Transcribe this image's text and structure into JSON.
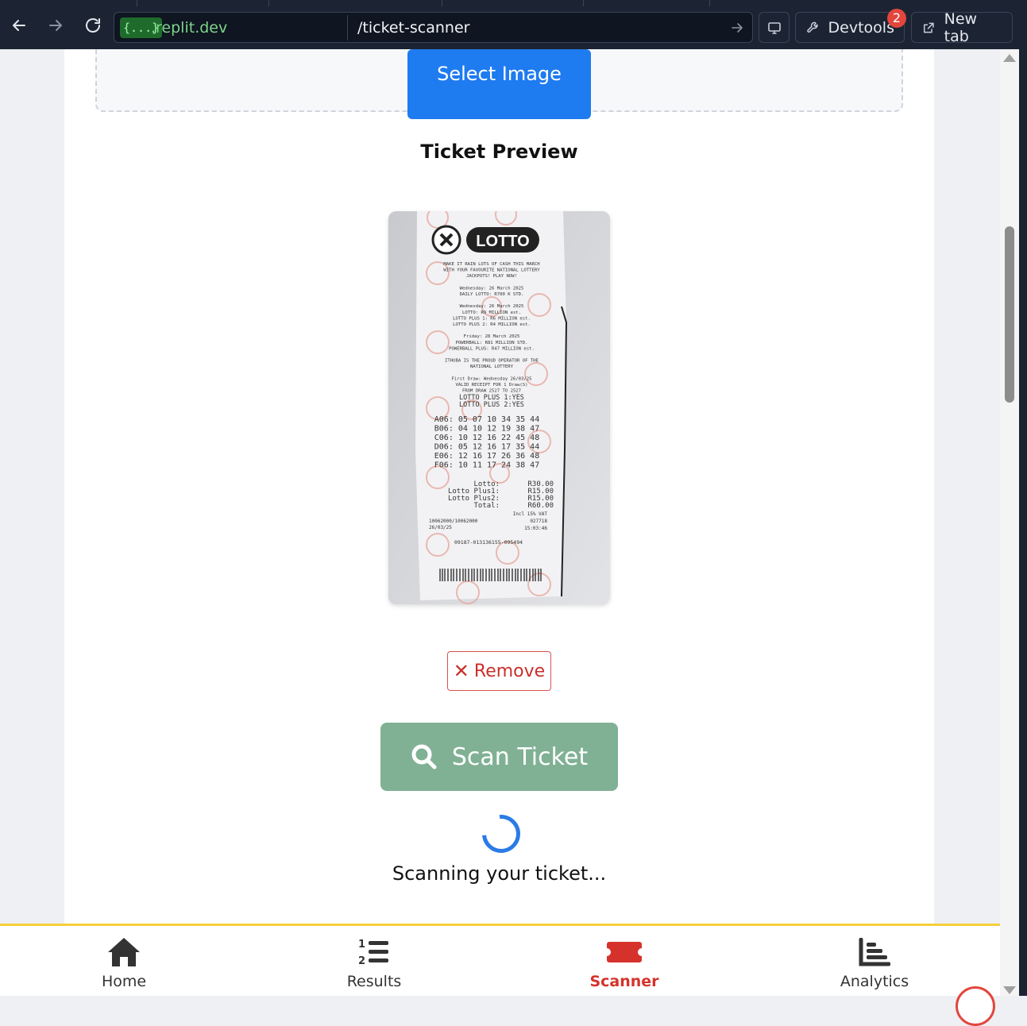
{
  "browser": {
    "url_chip": "{...}",
    "domain": ".replit.dev",
    "path": "/ticket-scanner",
    "devtools_label": "Devtools",
    "devtools_badge": "2",
    "new_tab_label": "New tab"
  },
  "upload": {
    "select_label": "Select Image"
  },
  "preview": {
    "title": "Ticket Preview",
    "remove_label": "Remove",
    "ticket": {
      "brand": "LOTTO",
      "lines_top": [
        "MAKE IT RAIN LOTS OF CASH THIS MARCH",
        "WITH YOUR FAVOURITE NATIONAL LOTTERY",
        "JACKPOTS! PLAY NOW!",
        "",
        "Wednesday: 26 March 2025",
        "DAILY LOTTO: R700 K STD.",
        "",
        "Wednesday: 26 March 2025",
        "LOTTO:       R9 MILLION est.",
        "LOTTO PLUS 1: R6 MILLION est.",
        "LOTTO PLUS 2: R4 MILLION est.",
        "",
        "Friday: 28 March 2025",
        "POWERBALL:    R81 MILLION STD.",
        "POWERBALL PLUS: R47 MILLION est.",
        "",
        "ITHUBA IS THE PROUD OPERATOR OF THE",
        "NATIONAL LOTTERY",
        "",
        "First Draw: Wednesday 26/03/25",
        "VALID RECEIPT FOR 1 Draw(S)",
        "FROM DRAW 2527 TO 2527"
      ],
      "plus_lines": [
        "LOTTO PLUS 1:YES",
        "LOTTO PLUS 2:YES"
      ],
      "boards": [
        "A06: 05 07 10 34 35 44",
        "B06: 04 10 12 19 38 47",
        "C06: 10 12 16 22 45 48",
        "D06: 05 12 16 17 35 44",
        "E06: 12 16 17 26 36 48",
        "F06: 10 11 17 24 38 47"
      ],
      "totals": [
        [
          "Lotto:",
          "R30.00"
        ],
        [
          "Lotto Plus1:",
          "R15.00"
        ],
        [
          "Lotto Plus2:",
          "R15.00"
        ],
        [
          "Total:",
          "R60.00"
        ]
      ],
      "vat": "Incl 15% VAT",
      "terminal": "10062000/10062000",
      "date": "26/03/25",
      "ref1": "027718",
      "time": "15:03:46",
      "serial": "09187-013136155-095494"
    }
  },
  "scan": {
    "button_label": "Scan Ticket",
    "status": "Scanning your ticket..."
  },
  "nav": {
    "items": [
      {
        "label": "Home",
        "icon": "home-icon"
      },
      {
        "label": "Results",
        "icon": "list-ol-icon"
      },
      {
        "label": "Scanner",
        "icon": "ticket-icon"
      },
      {
        "label": "Analytics",
        "icon": "chart-bar-icon"
      }
    ],
    "active": "Scanner",
    "active_color": "#d6322c",
    "accent_color": "#f5cf3a"
  },
  "colors": {
    "primary": "#1e7bf0",
    "scan_button": "#80b194",
    "remove": "#c9302c"
  }
}
